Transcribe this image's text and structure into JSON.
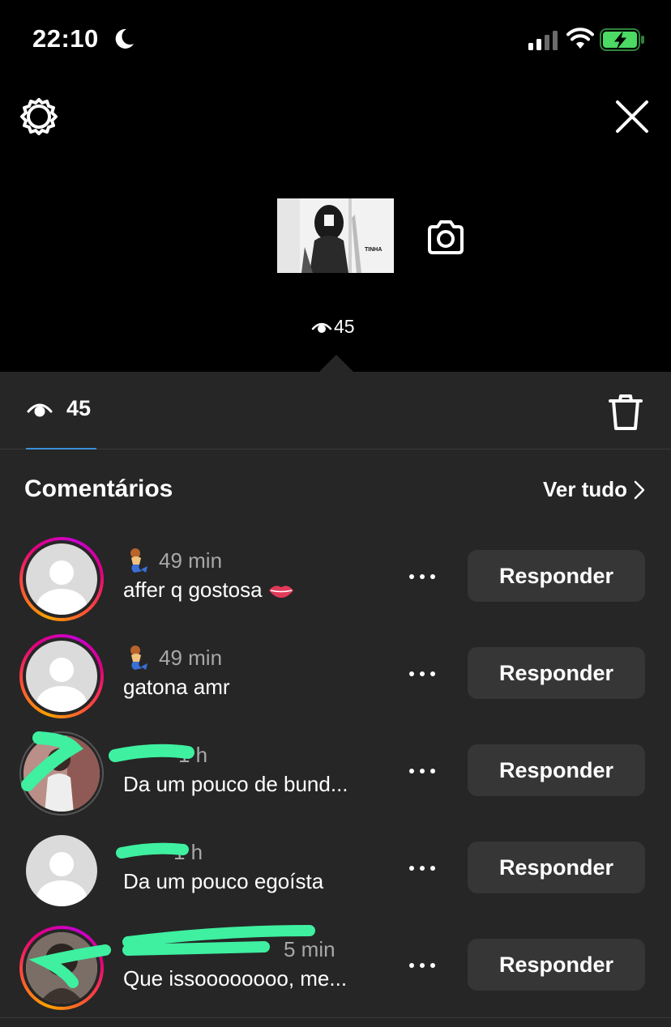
{
  "status_bar": {
    "time": "22:10",
    "battery_color": "#4cd964"
  },
  "story": {
    "thumbnail_text": "TINHA",
    "views": "45"
  },
  "tabs": {
    "views_count": "45"
  },
  "comments": {
    "title": "Comentários",
    "see_all": "Ver tudo",
    "items": [
      {
        "time": "49 min",
        "text": "affer q gostosa",
        "reply_label": "Responder"
      },
      {
        "time": "49 min",
        "text": "gatona amr",
        "reply_label": "Responder"
      },
      {
        "time": "1 h",
        "text": "Da um pouco de bund...",
        "reply_label": "Responder"
      },
      {
        "time": "1 h",
        "text": "Da um pouco egoísta",
        "reply_label": "Responder"
      },
      {
        "time": "5 min",
        "text": "Que issoooooooo, me...",
        "reply_label": "Responder"
      }
    ]
  },
  "colors": {
    "accent": "#3a8fd9",
    "panel": "#262626",
    "button": "#363636",
    "redaction": "#3ef0a0"
  }
}
